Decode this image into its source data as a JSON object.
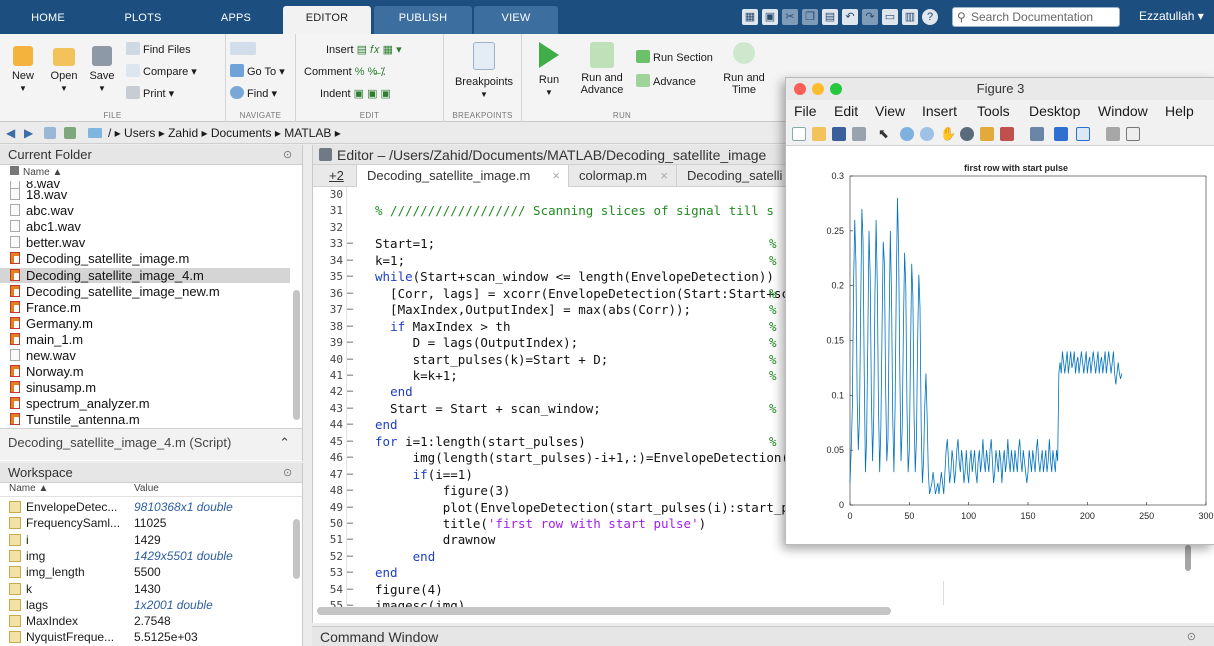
{
  "tabs": [
    "HOME",
    "PLOTS",
    "APPS",
    "EDITOR",
    "PUBLISH",
    "VIEW"
  ],
  "search_placeholder": "Search Documentation",
  "user": "Ezzatullah ▾",
  "ribbon": {
    "file": {
      "new": "New",
      "open": "Open",
      "save": "Save",
      "find_files": "Find Files",
      "compare": "Compare ▾",
      "print": "Print ▾",
      "label": "FILE"
    },
    "navigate": {
      "goto": "Go To ▾",
      "find": "Find ▾",
      "label": "NAVIGATE"
    },
    "edit": {
      "insert": "Insert",
      "comment": "Comment",
      "indent": "Indent",
      "label": "EDIT"
    },
    "breakpoints": {
      "btn": "Breakpoints",
      "label": "BREAKPOINTS"
    },
    "run": {
      "run": "Run",
      "run_advance_1": "Run and",
      "run_advance_2": "Advance",
      "run_section": "Run Section",
      "advance": "Advance",
      "run_time_1": "Run and",
      "run_time_2": "Time",
      "label": "RUN"
    }
  },
  "address": [
    "/",
    "Users",
    "Zahid",
    "Documents",
    "MATLAB"
  ],
  "current_folder": {
    "title": "Current Folder",
    "header": "Name ▲",
    "files": [
      {
        "name": "8.wav",
        "m": false
      },
      {
        "name": "18.wav",
        "m": false
      },
      {
        "name": "abc.wav",
        "m": false
      },
      {
        "name": "abc1.wav",
        "m": false
      },
      {
        "name": "better.wav",
        "m": false
      },
      {
        "name": "Decoding_satellite_image.m",
        "m": true
      },
      {
        "name": "Decoding_satellite_image_4.m",
        "m": true
      },
      {
        "name": "Decoding_satellite_image_new.m",
        "m": true
      },
      {
        "name": "France.m",
        "m": true
      },
      {
        "name": "Germany.m",
        "m": true
      },
      {
        "name": "main_1.m",
        "m": true
      },
      {
        "name": "new.wav",
        "m": false
      },
      {
        "name": "Norway.m",
        "m": true
      },
      {
        "name": "sinusamp.m",
        "m": true
      },
      {
        "name": "spectrum_analyzer.m",
        "m": true
      },
      {
        "name": "Tunstile_antenna.m",
        "m": true
      }
    ],
    "details": "Decoding_satellite_image_4.m (Script)"
  },
  "workspace": {
    "title": "Workspace",
    "col_name": "Name ▲",
    "col_value": "Value",
    "vars": [
      {
        "name": "EnvelopeDetec...",
        "value": "9810368x1 double",
        "blue": true
      },
      {
        "name": "FrequencySaml...",
        "value": "11025",
        "blue": false
      },
      {
        "name": "i",
        "value": "1429",
        "blue": false
      },
      {
        "name": "img",
        "value": "1429x5501 double",
        "blue": true
      },
      {
        "name": "img_length",
        "value": "5500",
        "blue": false
      },
      {
        "name": "k",
        "value": "1430",
        "blue": false
      },
      {
        "name": "lags",
        "value": "1x2001 double",
        "blue": true
      },
      {
        "name": "MaxIndex",
        "value": "2.7548",
        "blue": false
      },
      {
        "name": "NyquistFreque...",
        "value": "5.5125e+03",
        "blue": false
      }
    ]
  },
  "editor": {
    "title": "Editor – /Users/Zahid/Documents/MATLAB/Decoding_satellite_image",
    "plus": "+2",
    "tabs": [
      "Decoding_satellite_image.m",
      "colormap.m",
      "Decoding_satelli"
    ],
    "lines": [
      {
        "n": "30",
        "t": "",
        "cls": ""
      },
      {
        "n": "31",
        "t": "% ////////////////// Scanning slices of signal till s",
        "cls": "cm"
      },
      {
        "n": "32",
        "t": "",
        "cls": ""
      },
      {
        "n": "33",
        "t": "Start=1;",
        "cls": "",
        "dash": true
      },
      {
        "n": "34",
        "t": "k=1;",
        "cls": "",
        "dash": true
      },
      {
        "n": "35",
        "t": "while(Start+scan_window <= length(EnvelopeDetection))",
        "cls": "",
        "dash": true
      },
      {
        "n": "36",
        "t": "  [Corr, lags] = xcorr(EnvelopeDetection(Start:Start+sc",
        "cls": "",
        "dash": true
      },
      {
        "n": "37",
        "t": "  [MaxIndex,OutputIndex] = max(abs(Corr));",
        "cls": "",
        "dash": true
      },
      {
        "n": "38",
        "t": "  if MaxIndex > th",
        "cls": "",
        "dash": true
      },
      {
        "n": "39",
        "t": "     D = lags(OutputIndex);",
        "cls": "",
        "dash": true
      },
      {
        "n": "40",
        "t": "     start_pulses(k)=Start + D;",
        "cls": "",
        "dash": true
      },
      {
        "n": "41",
        "t": "     k=k+1;",
        "cls": "",
        "dash": true
      },
      {
        "n": "42",
        "t": "  end",
        "cls": "",
        "dash": true
      },
      {
        "n": "43",
        "t": "  Start = Start + scan_window;",
        "cls": "",
        "dash": true
      },
      {
        "n": "44",
        "t": "end",
        "cls": "",
        "dash": true
      },
      {
        "n": "45",
        "t": "for i=1:length(start_pulses)",
        "cls": "",
        "dash": true
      },
      {
        "n": "46",
        "t": "     img(length(start_pulses)-i+1,:)=EnvelopeDetection(",
        "cls": "",
        "dash": true
      },
      {
        "n": "47",
        "t": "     if(i==1)",
        "cls": "",
        "dash": true
      },
      {
        "n": "48",
        "t": "         figure(3)",
        "cls": "",
        "dash": true
      },
      {
        "n": "49",
        "t": "         plot(EnvelopeDetection(start_pulses(i):start_p",
        "cls": "",
        "dash": true
      },
      {
        "n": "50",
        "t": "         title('first row with start pulse')",
        "cls": "",
        "dash": true
      },
      {
        "n": "51",
        "t": "         drawnow",
        "cls": "",
        "dash": true
      },
      {
        "n": "52",
        "t": "     end",
        "cls": "",
        "dash": true
      },
      {
        "n": "53",
        "t": "end",
        "cls": "",
        "dash": true
      },
      {
        "n": "54",
        "t": "figure(4)",
        "cls": "",
        "dash": true
      },
      {
        "n": "55",
        "t": "imagesc(img)",
        "cls": "",
        "dash": true
      }
    ],
    "comment_lines": [
      33,
      34,
      36,
      37,
      38,
      39,
      40,
      41,
      43,
      45
    ]
  },
  "command_window": "Command Window",
  "figure": {
    "title": "Figure 3",
    "menu": [
      "File",
      "Edit",
      "View",
      "Insert",
      "Tools",
      "Desktop",
      "Window",
      "Help"
    ]
  },
  "chart_data": {
    "type": "line",
    "title": "first row with start pulse",
    "xlim": [
      0,
      300
    ],
    "ylim": [
      0,
      0.3
    ],
    "xticks": [
      0,
      50,
      100,
      150,
      200,
      250,
      300
    ],
    "yticks": [
      0,
      0.05,
      0.1,
      0.15,
      0.2,
      0.25,
      0.3
    ],
    "color": "#0072bd",
    "y": [
      0.02,
      0.05,
      0.09,
      0.2,
      0.26,
      0.22,
      0.1,
      0.05,
      0.08,
      0.18,
      0.27,
      0.24,
      0.12,
      0.03,
      0.06,
      0.15,
      0.25,
      0.21,
      0.1,
      0.04,
      0.08,
      0.19,
      0.26,
      0.2,
      0.09,
      0.03,
      0.07,
      0.16,
      0.24,
      0.22,
      0.11,
      0.04,
      0.06,
      0.17,
      0.25,
      0.19,
      0.08,
      0.03,
      0.09,
      0.2,
      0.28,
      0.23,
      0.12,
      0.04,
      0.07,
      0.16,
      0.23,
      0.2,
      0.09,
      0.03,
      0.05,
      0.14,
      0.22,
      0.19,
      0.08,
      0.03,
      0.06,
      0.15,
      0.21,
      0.18,
      0.07,
      0.02,
      0.04,
      0.09,
      0.12,
      0.08,
      0.03,
      0.01,
      0.015,
      0.02,
      0.03,
      0.02,
      0.01,
      0.015,
      0.02,
      0.01,
      0.02,
      0.03,
      0.02,
      0.01,
      0.03,
      0.05,
      0.06,
      0.04,
      0.02,
      0.03,
      0.05,
      0.04,
      0.02,
      0.03,
      0.05,
      0.06,
      0.04,
      0.03,
      0.05,
      0.04,
      0.02,
      0.03,
      0.05,
      0.03,
      0.02,
      0.04,
      0.05,
      0.03,
      0.04,
      0.05,
      0.03,
      0.02,
      0.04,
      0.05,
      0.03,
      0.04,
      0.06,
      0.04,
      0.03,
      0.05,
      0.04,
      0.03,
      0.05,
      0.06,
      0.04,
      0.02,
      0.03,
      0.05,
      0.04,
      0.03,
      0.05,
      0.04,
      0.02,
      0.04,
      0.05,
      0.03,
      0.04,
      0.06,
      0.04,
      0.03,
      0.05,
      0.04,
      0.03,
      0.05,
      0.04,
      0.03,
      0.05,
      0.06,
      0.04,
      0.03,
      0.05,
      0.04,
      0.03,
      0.02,
      0.03,
      0.05,
      0.04,
      0.03,
      0.05,
      0.04,
      0.03,
      0.05,
      0.06,
      0.04,
      0.03,
      0.04,
      0.05,
      0.03,
      0.04,
      0.05,
      0.03,
      0.04,
      0.06,
      0.04,
      0.03,
      0.05,
      0.04,
      0.03,
      0.05,
      0.04,
      0.12,
      0.13,
      0.12,
      0.14,
      0.13,
      0.12,
      0.13,
      0.14,
      0.12,
      0.13,
      0.14,
      0.125,
      0.13,
      0.14,
      0.12,
      0.13,
      0.135,
      0.12,
      0.13,
      0.14,
      0.13,
      0.12,
      0.13,
      0.14,
      0.12,
      0.13,
      0.135,
      0.12,
      0.13,
      0.14,
      0.13,
      0.12,
      0.13,
      0.14,
      0.12,
      0.13,
      0.135,
      0.12,
      0.13,
      0.14,
      0.12,
      0.13,
      0.14,
      0.13,
      0.12,
      0.13,
      0.14,
      0.12,
      0.11,
      0.12,
      0.13,
      0.12,
      0.115,
      0.12
    ]
  }
}
